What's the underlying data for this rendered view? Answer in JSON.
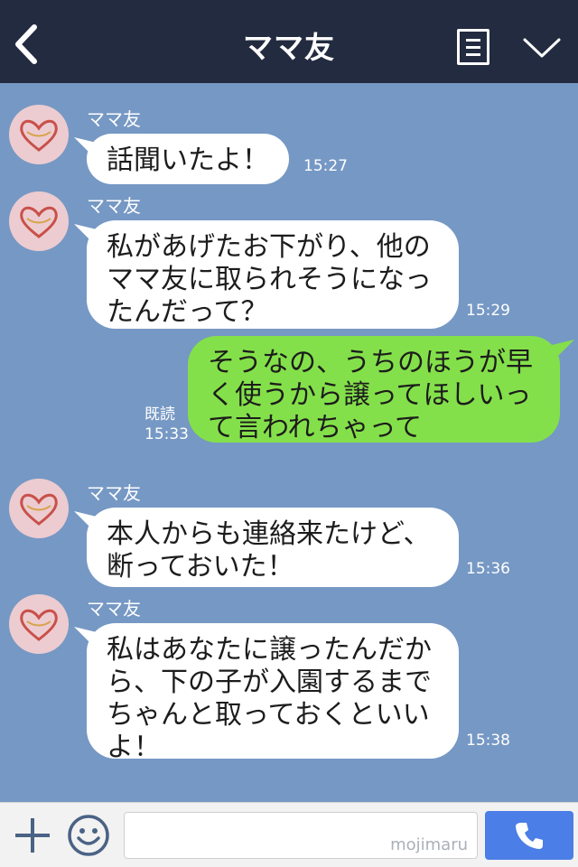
{
  "header": {
    "title": "ママ友"
  },
  "icons": {
    "back": "chevron-left-icon",
    "menu": "list-menu-icon",
    "expand": "chevron-down-icon",
    "add": "plus-icon",
    "emoji": "smiley-icon",
    "call": "phone-icon"
  },
  "colors": {
    "header_bg": "#232b40",
    "chat_bg": "#7698c4",
    "my_bubble": "#84e04a",
    "their_bubble": "#ffffff",
    "call_button": "#4b7ee6"
  },
  "messages": [
    {
      "sender": "ママ友",
      "text": "話聞いたよ！",
      "time": "15:27"
    },
    {
      "sender": "ママ友",
      "text": "私があげたお下がり、他の\nママ友に取られそうになっ\nたんだって？",
      "time": "15:29"
    },
    {
      "sender": "me",
      "text": "そうなの、うちのほうが早\nく使うから譲ってほしいっ\nて言われちゃって",
      "read": "既読",
      "time": "15:33"
    },
    {
      "sender": "ママ友",
      "text": "本人からも連絡来たけど、\n断っておいた！",
      "time": "15:36"
    },
    {
      "sender": "ママ友",
      "text": "私はあなたに譲ったんだか\nら、下の子が入園するまで\nちゃんと取っておくといい\nよ！",
      "time": "15:38"
    }
  ],
  "input": {
    "watermark": "mojimaru"
  }
}
